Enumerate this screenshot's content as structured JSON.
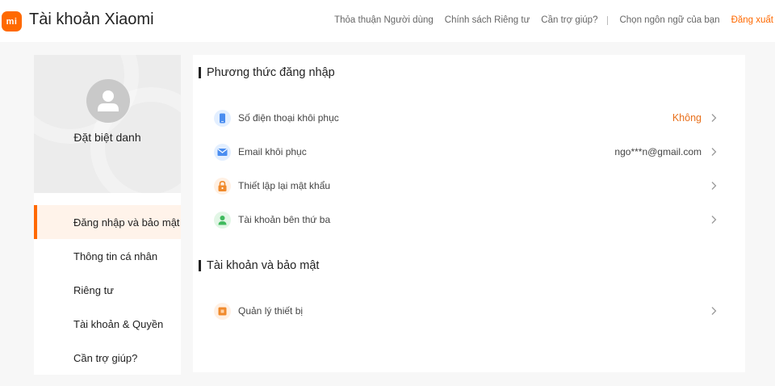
{
  "header": {
    "logo_text": "mi",
    "title": "Tài khoản Xiaomi",
    "links": {
      "user_agreement": "Thỏa thuận Người dùng",
      "privacy_policy": "Chính sách Riêng tư",
      "help": "Cần trợ giúp?",
      "language": "Chọn ngôn ngữ của bạn",
      "logout": "Đăng xuất"
    }
  },
  "sidebar": {
    "nickname": "Đặt biệt danh",
    "items": [
      {
        "label": "Đăng nhập và bảo mật",
        "active": true
      },
      {
        "label": "Thông tin cá nhân",
        "active": false
      },
      {
        "label": "Riêng tư",
        "active": false
      },
      {
        "label": "Tài khoản & Quyền",
        "active": false
      },
      {
        "label": "Cần trợ giúp?",
        "active": false
      }
    ]
  },
  "main": {
    "login_section": {
      "title": "Phương thức đăng nhập",
      "rows": [
        {
          "icon": "phone-icon",
          "label": "Số điện thoại khôi phục",
          "value": "Không"
        },
        {
          "icon": "email-icon",
          "label": "Email khôi phục",
          "value": "ngo***n@gmail.com"
        },
        {
          "icon": "lock-icon",
          "label": "Thiết lập lại mật khẩu",
          "value": ""
        },
        {
          "icon": "user-icon",
          "label": "Tài khoản bên thứ ba",
          "value": ""
        }
      ]
    },
    "security_section": {
      "title": "Tài khoản và bảo mật",
      "rows": [
        {
          "icon": "device-icon",
          "label": "Quản lý thiết bị",
          "value": ""
        }
      ]
    }
  },
  "colors": {
    "accent": "#ff6900",
    "phone_icon_bg": "#e3efff",
    "email_icon_bg": "#e3efff",
    "lock_icon_bg": "#fff0e3",
    "user_icon_bg": "#e2f6e6",
    "device_icon_bg": "#fff0e3"
  }
}
